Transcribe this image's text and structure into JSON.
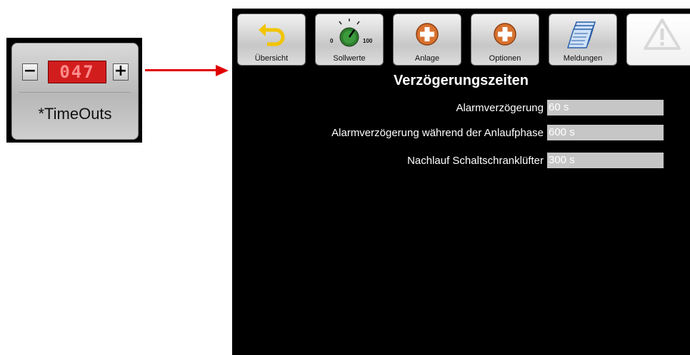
{
  "widget": {
    "minus_label": "−",
    "plus_label": "+",
    "display_value": "047",
    "label": "*TimeOuts"
  },
  "toolbar": {
    "buttons": [
      {
        "label": "Übersicht",
        "icon": "back-arrow-icon"
      },
      {
        "label": "Sollwerte",
        "icon": "dial-icon",
        "dial_min": "0",
        "dial_max": "100"
      },
      {
        "label": "Anlage",
        "icon": "plus-circle-icon"
      },
      {
        "label": "Optionen",
        "icon": "plus-circle-icon"
      },
      {
        "label": "Meldungen",
        "icon": "documents-icon"
      },
      {
        "label": "",
        "icon": "warning-icon"
      }
    ]
  },
  "page": {
    "title": "Verzögerungszeiten",
    "rows": [
      {
        "label": "Alarmverzögerung",
        "value": "60 s"
      },
      {
        "label": "Alarmverzögerung während der Anlaufphase",
        "value": "600 s"
      },
      {
        "label": "Nachlauf Schaltschranklüfter",
        "value": "300 s"
      }
    ]
  },
  "colors": {
    "accent_red": "#e00000",
    "display_red": "#d21d1d",
    "panel_bg": "#000000",
    "field_bg": "#c6c6c6",
    "icon_orange": "#d8722f",
    "icon_yellow": "#f2c400"
  }
}
